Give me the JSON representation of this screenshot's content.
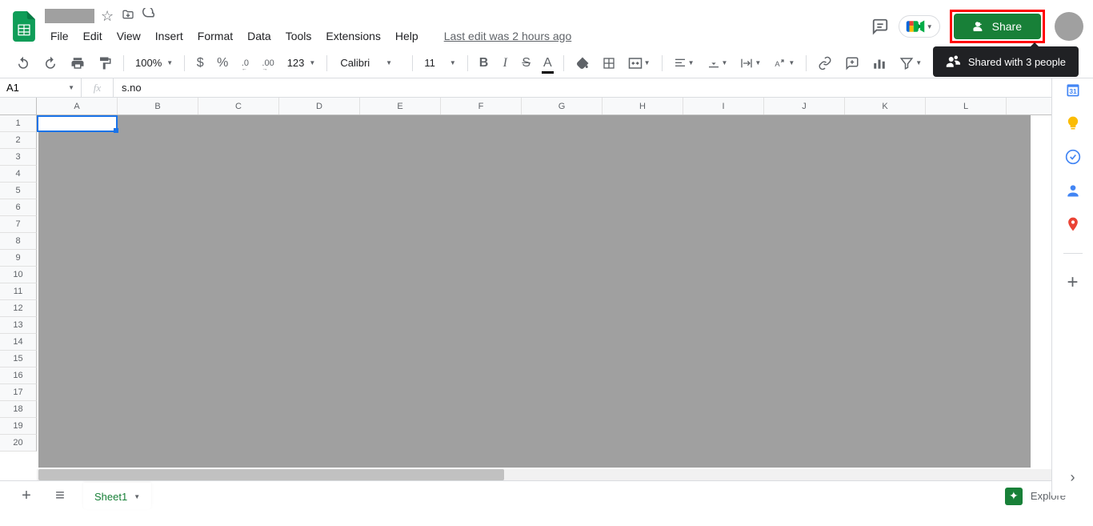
{
  "header": {
    "doc_title_redacted": true,
    "last_edit": "Last edit was 2 hours ago",
    "share_label": "Share",
    "tooltip_text": "Shared with 3 people"
  },
  "menubar": {
    "items": [
      "File",
      "Edit",
      "View",
      "Insert",
      "Format",
      "Data",
      "Tools",
      "Extensions",
      "Help"
    ]
  },
  "toolbar": {
    "zoom": "100%",
    "currency": "$",
    "percent": "%",
    "dec_decrease": ".0",
    "dec_increase": ".00",
    "more_formats": "123",
    "font": "Calibri",
    "font_size": "11"
  },
  "formula_bar": {
    "name_box": "A1",
    "fx": "fx",
    "content": "s.no"
  },
  "grid": {
    "columns": [
      "A",
      "B",
      "C",
      "D",
      "E",
      "F",
      "G",
      "H",
      "I",
      "J",
      "K",
      "L"
    ],
    "rows": [
      "1",
      "2",
      "3",
      "4",
      "5",
      "6",
      "7",
      "8",
      "9",
      "10",
      "11",
      "12",
      "13",
      "14",
      "15",
      "16",
      "17",
      "18",
      "19",
      "20"
    ]
  },
  "sheet_tabs": {
    "active": "Sheet1",
    "explore": "Explore"
  }
}
